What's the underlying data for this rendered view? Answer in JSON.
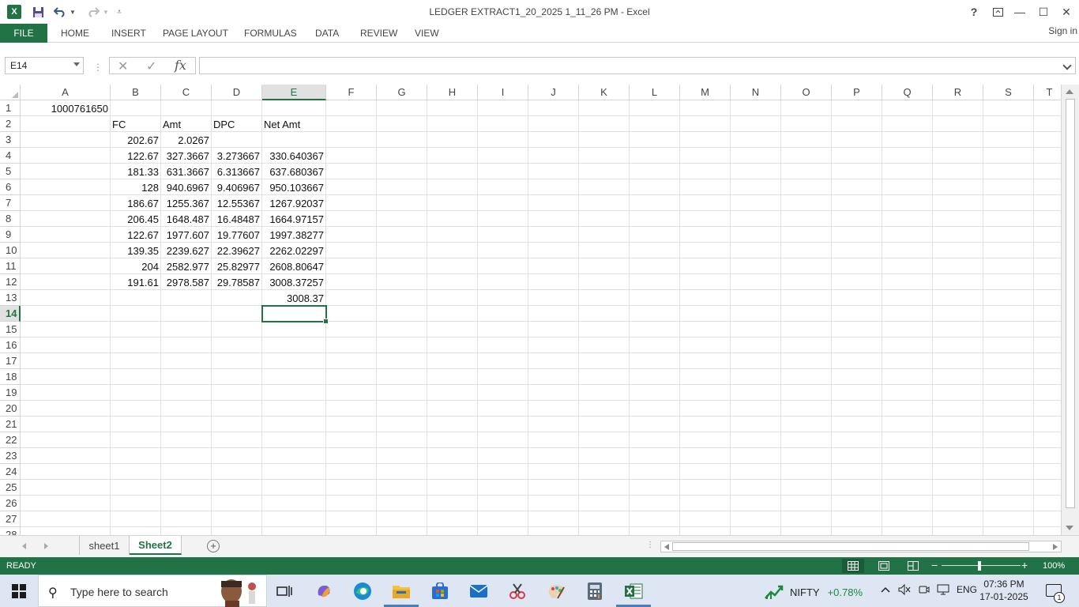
{
  "window": {
    "title": "LEDGER EXTRACT1_20_2025 1_11_26 PM - Excel",
    "help": "?",
    "minimize": "—",
    "maximize": "☐",
    "close": "✕"
  },
  "qat": {
    "save": "save-icon",
    "undo": "undo-icon",
    "redo": "redo-icon",
    "customize": "customize-icon"
  },
  "ribbon": {
    "file": "FILE",
    "tabs": [
      "HOME",
      "INSERT",
      "PAGE LAYOUT",
      "FORMULAS",
      "DATA",
      "REVIEW",
      "VIEW"
    ],
    "sign_in": "Sign in"
  },
  "formula_bar": {
    "name_box": "E14",
    "cancel": "✕",
    "enter": "✓",
    "fx": "fx",
    "value": ""
  },
  "columns": [
    "A",
    "B",
    "C",
    "D",
    "E",
    "F",
    "G",
    "H",
    "I",
    "J",
    "K",
    "L",
    "M",
    "N",
    "O",
    "P",
    "Q",
    "R",
    "S",
    "T"
  ],
  "rows": [
    "1",
    "2",
    "3",
    "4",
    "5",
    "6",
    "7",
    "8",
    "9",
    "10",
    "11",
    "12",
    "13",
    "14",
    "15",
    "16",
    "17",
    "18",
    "19",
    "20",
    "21",
    "22",
    "23",
    "24",
    "25",
    "26",
    "27",
    "28"
  ],
  "selected": {
    "col": "E",
    "row": "14"
  },
  "cells": {
    "A1": "1000761650",
    "B2": "FC",
    "C2": "Amt",
    "D2": "DPC",
    "E2": "Net Amt",
    "B3": "202.67",
    "C3": "2.0267",
    "B4": "122.67",
    "C4": "327.3667",
    "D4": "3.273667",
    "E4": "330.640367",
    "B5": "181.33",
    "C5": "631.3667",
    "D5": "6.313667",
    "E5": "637.680367",
    "B6": "128",
    "C6": "940.6967",
    "D6": "9.406967",
    "E6": "950.103667",
    "B7": "186.67",
    "C7": "1255.367",
    "D7": "12.55367",
    "E7": "1267.92037",
    "B8": "206.45",
    "C8": "1648.487",
    "D8": "16.48487",
    "E8": "1664.97157",
    "B9": "122.67",
    "C9": "1977.607",
    "D9": "19.77607",
    "E9": "1997.38277",
    "B10": "139.35",
    "C10": "2239.627",
    "D10": "22.39627",
    "E10": "2262.02297",
    "B11": "204",
    "C11": "2582.977",
    "D11": "25.82977",
    "E11": "2608.80647",
    "B12": "191.61",
    "C12": "2978.587",
    "D12": "29.78587",
    "E12": "3008.37257",
    "E13": "3008.37"
  },
  "sheets": {
    "tab1": "sheet1",
    "tab2": "Sheet2",
    "add": "+"
  },
  "status": {
    "text": "READY",
    "zoom": "100%",
    "zoom_level_percent": 100
  },
  "taskbar": {
    "search_placeholder": "Type here to search",
    "nifty_label": "NIFTY",
    "nifty_change": "+0.78%",
    "nifty_color": "#1a8a3a",
    "language": "ENG",
    "time": "07:36 PM",
    "date": "17-01-2025",
    "notification_count": "1"
  },
  "colors": {
    "excel_green": "#217346",
    "taskbar_bg": "#dde6f2"
  }
}
